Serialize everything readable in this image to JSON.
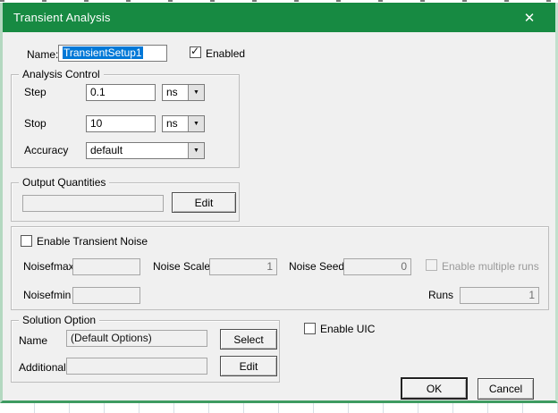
{
  "window": {
    "title": "Transient Analysis"
  },
  "icons": {
    "close": "✕",
    "check": "✓",
    "dropdown": "▼"
  },
  "name_row": {
    "label": "Name:",
    "value": "TransientSetup1",
    "enabled_label": "Enabled"
  },
  "analysis_control": {
    "title": "Analysis Control",
    "step_label": "Step",
    "step_value": "0.1",
    "step_unit": "ns",
    "stop_label": "Stop",
    "stop_value": "10",
    "stop_unit": "ns",
    "accuracy_label": "Accuracy",
    "accuracy_value": "default"
  },
  "output_quantities": {
    "title": "Output Quantities",
    "value": "",
    "edit_label": "Edit"
  },
  "noise": {
    "enable_label": "Enable Transient Noise",
    "noisefmax_label": "Noisefmax",
    "noisefmax_value": "",
    "noise_scale_label": "Noise Scale",
    "noise_scale_value": "1",
    "noise_seed_label": "Noise Seed",
    "noise_seed_value": "0",
    "enable_multiple_label": "Enable multiple runs",
    "noisefmin_label": "Noisefmin",
    "noisefmin_value": "",
    "runs_label": "Runs",
    "runs_value": "1"
  },
  "solution_option": {
    "title": "Solution Option",
    "name_label": "Name",
    "name_value": "(Default Options)",
    "select_label": "Select",
    "additional_label": "Additional",
    "additional_value": "",
    "edit_label": "Edit"
  },
  "enable_uic_label": "Enable UIC",
  "buttons": {
    "ok": "OK",
    "cancel": "Cancel"
  },
  "colors": {
    "titlebar_green": "#178a42",
    "selection_blue": "#0078d7",
    "border_green": "#3e9b61"
  }
}
